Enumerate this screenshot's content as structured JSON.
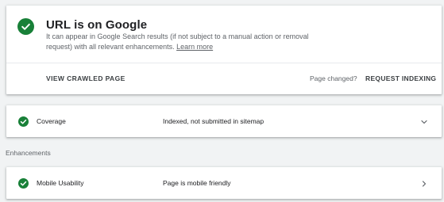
{
  "status": {
    "title": "URL is on Google",
    "description": "It can appear in Google Search results (if not subject to a manual action or removal request) with all relevant enhancements.",
    "learn_more": "Learn more",
    "view_crawled_page": "VIEW CRAWLED PAGE",
    "page_changed": "Page changed?",
    "request_indexing": "REQUEST INDEXING",
    "icon": "check-circle-icon",
    "status_color": "#188038"
  },
  "coverage": {
    "label": "Coverage",
    "value": "Indexed, not submitted in sitemap",
    "icon": "check-circle-icon",
    "action_icon": "chevron-down-icon"
  },
  "enhancements": {
    "section_label": "Enhancements",
    "items": [
      {
        "label": "Mobile Usability",
        "value": "Page is mobile friendly",
        "icon": "check-circle-icon",
        "action_icon": "chevron-right-icon"
      }
    ]
  }
}
